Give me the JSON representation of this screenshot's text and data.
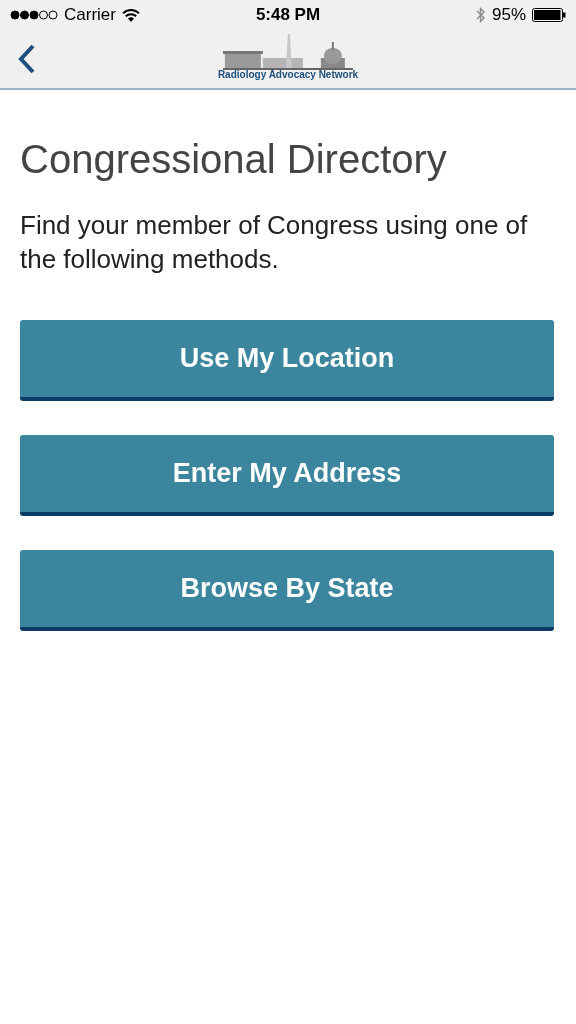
{
  "status_bar": {
    "carrier": "Carrier",
    "time": "5:48 PM",
    "battery": "95%"
  },
  "nav": {
    "logo_text": "Radiology Advocacy Network"
  },
  "title": "Congressional Directory",
  "intro": "Find your member of Congress using one of the following methods.",
  "buttons": [
    {
      "label": "Use My Location"
    },
    {
      "label": "Enter My Address"
    },
    {
      "label": "Browse By State"
    }
  ]
}
